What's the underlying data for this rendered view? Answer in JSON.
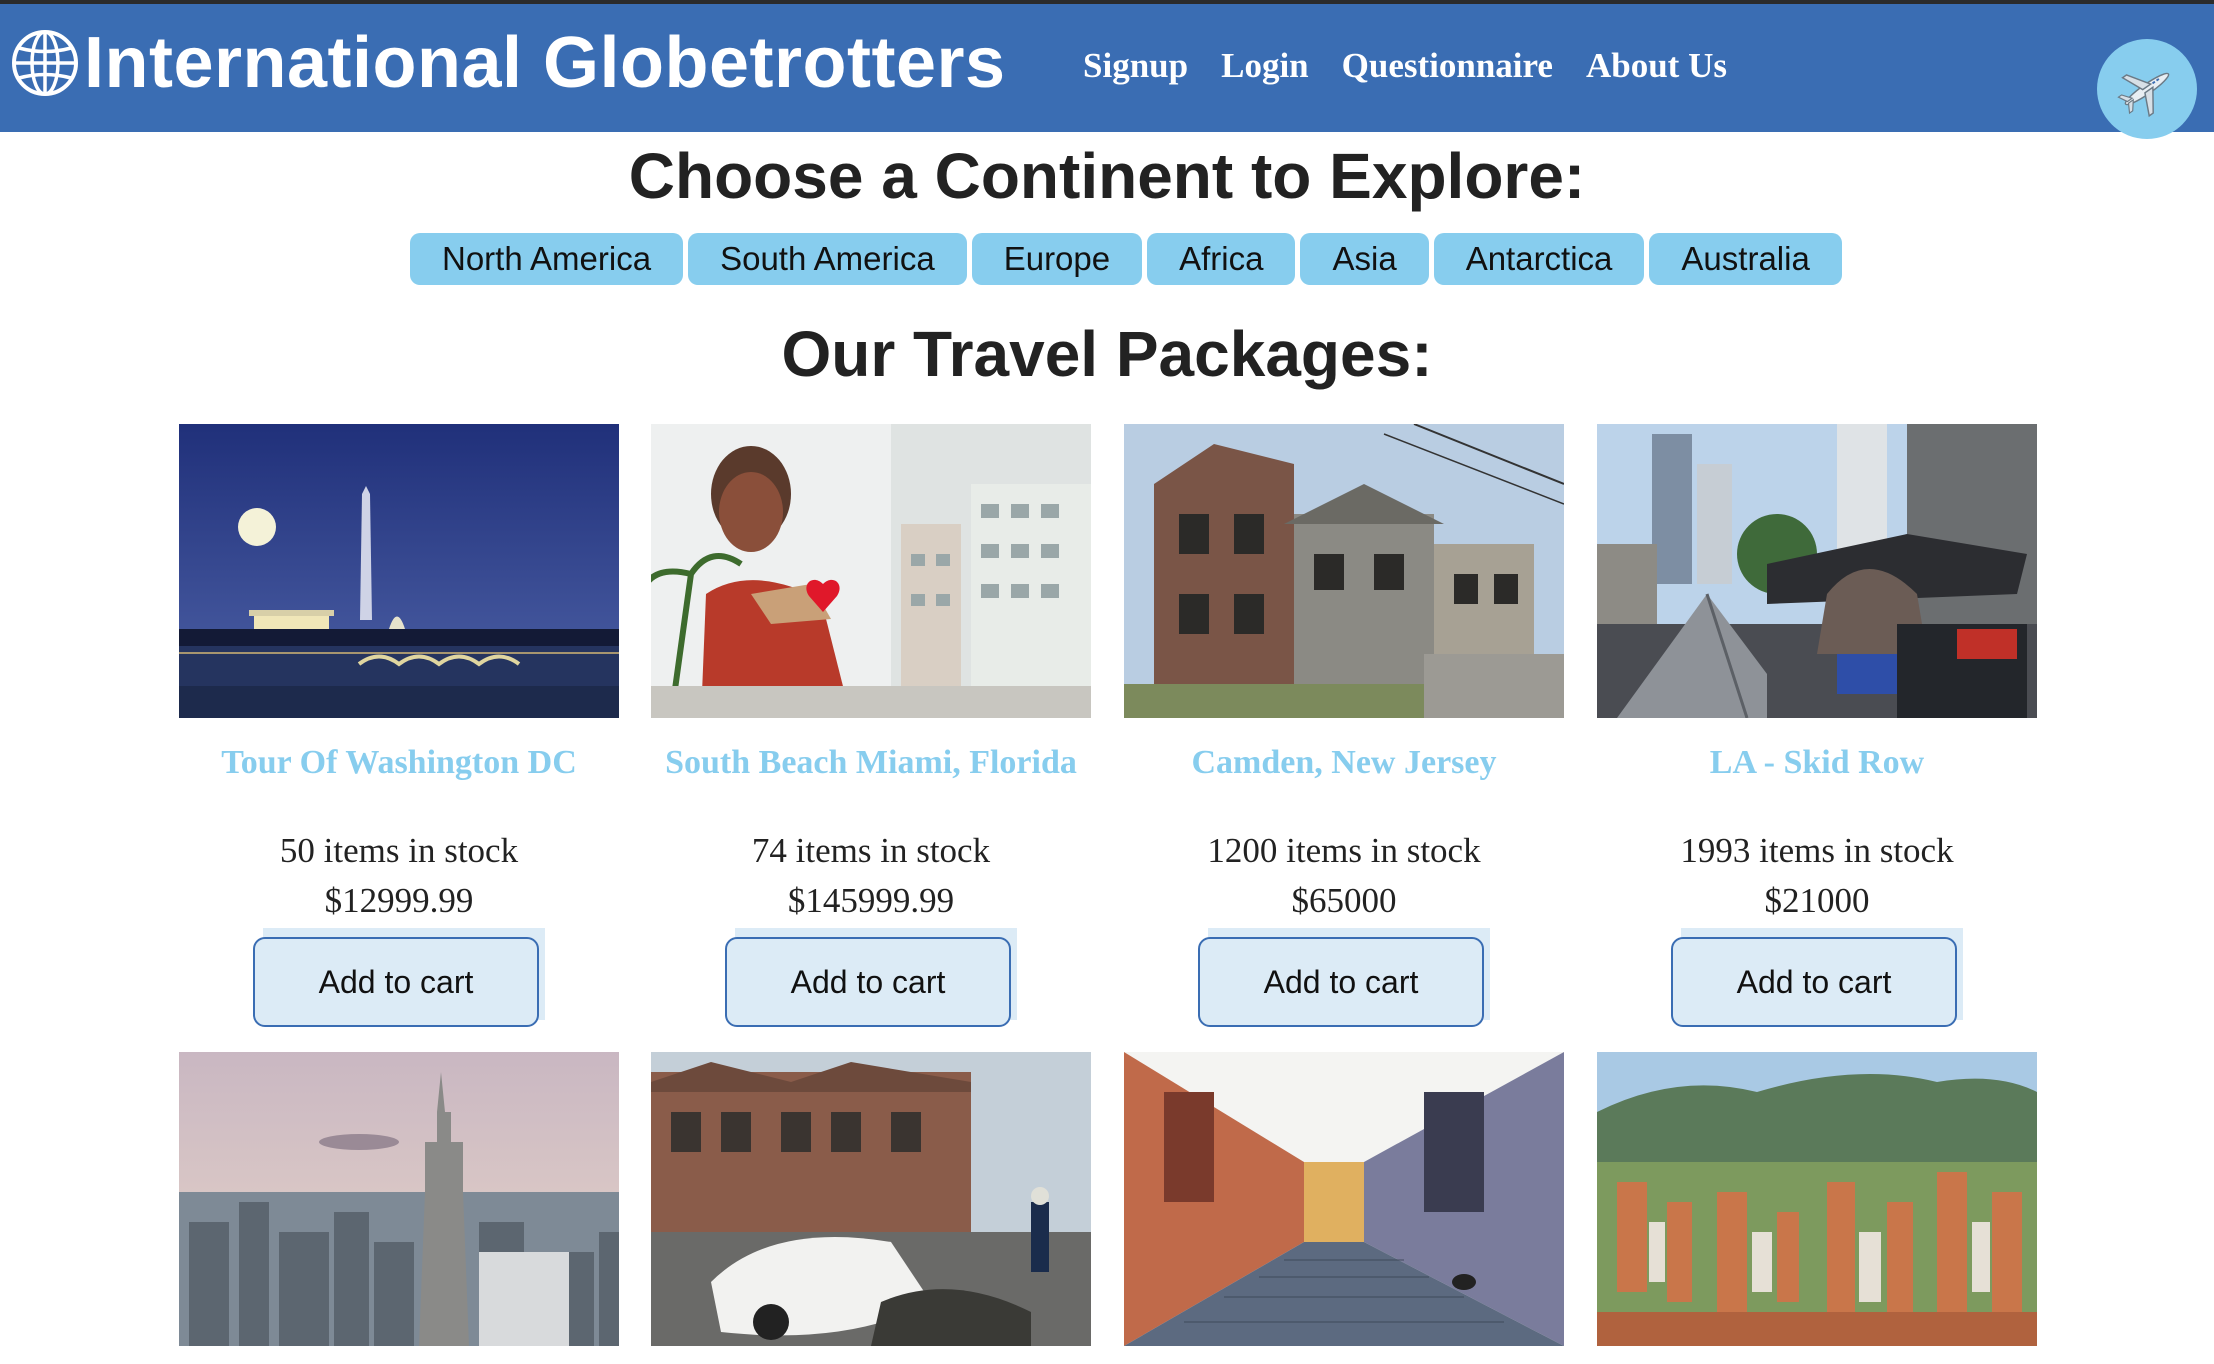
{
  "header": {
    "brand_title": "International Globetrotters",
    "nav": [
      "Signup",
      "Login",
      "Questionnaire",
      "About Us"
    ]
  },
  "continents": {
    "title": "Choose a Continent to Explore:",
    "items": [
      "North America",
      "South America",
      "Europe",
      "Africa",
      "Asia",
      "Antarctica",
      "Australia"
    ]
  },
  "packages": {
    "title": "Our Travel Packages:",
    "items": [
      {
        "name": "Tour Of Washington DC",
        "stock": "50 items in stock",
        "price": "$12999.99",
        "button": "Add to cart"
      },
      {
        "name": "South Beach Miami, Florida",
        "stock": "74 items in stock",
        "price": "$145999.99",
        "button": "Add to cart"
      },
      {
        "name": "Camden, New Jersey",
        "stock": "1200 items in stock",
        "price": "$65000",
        "button": "Add to cart"
      },
      {
        "name": "LA - Skid Row",
        "stock": "1993 items in stock",
        "price": "$21000",
        "button": "Add to cart"
      }
    ]
  },
  "colors": {
    "header_bg": "#3a6db3",
    "accent_light_blue": "#87cdee",
    "button_bg": "#dcebf6",
    "button_border": "#3a6db3"
  },
  "icons": {
    "brand": "globe-icon",
    "badge": "airplane-icon"
  }
}
